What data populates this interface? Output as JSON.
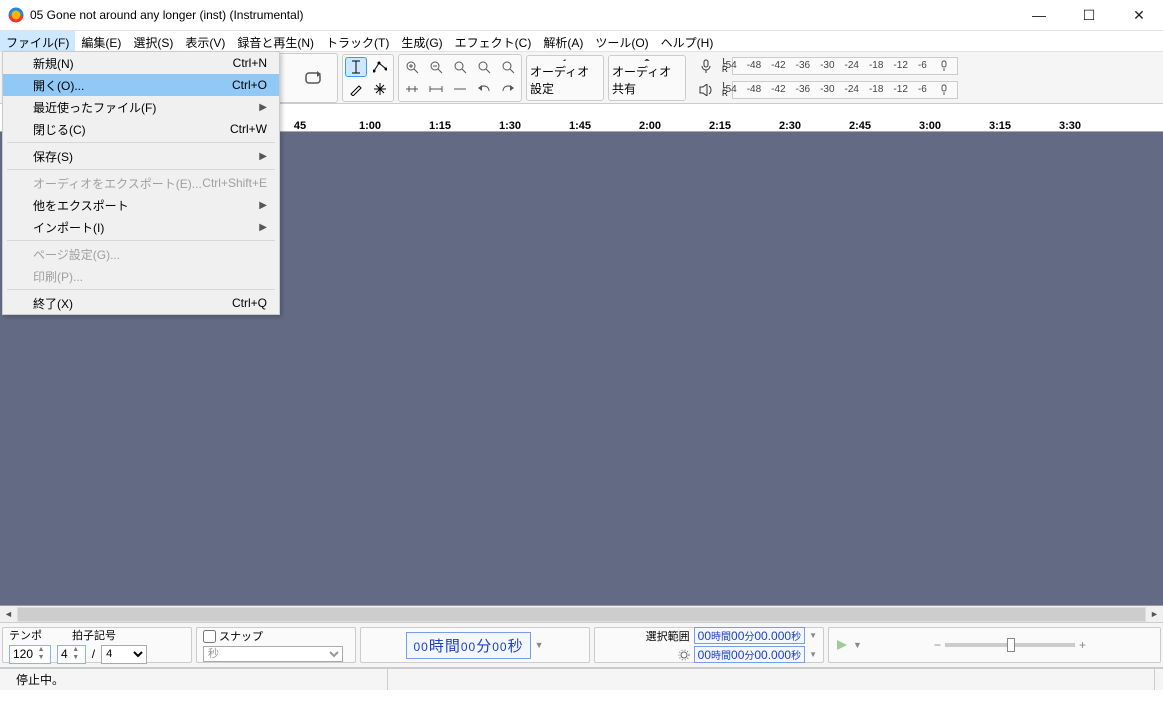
{
  "window": {
    "title": "05 Gone not around any longer (inst) (Instrumental)"
  },
  "menubar": [
    "ファイル(F)",
    "編集(E)",
    "選択(S)",
    "表示(V)",
    "録音と再生(N)",
    "トラック(T)",
    "生成(G)",
    "エフェクト(C)",
    "解析(A)",
    "ツール(O)",
    "ヘルプ(H)"
  ],
  "menu_open_index": 0,
  "file_menu": [
    {
      "label": "新規(N)",
      "accel": "Ctrl+N"
    },
    {
      "label": "開く(O)...",
      "accel": "Ctrl+O",
      "highlight": true
    },
    {
      "label": "最近使ったファイル(F)",
      "submenu": true
    },
    {
      "label": "閉じる(C)",
      "accel": "Ctrl+W"
    },
    {
      "sep": true
    },
    {
      "label": "保存(S)",
      "submenu": true
    },
    {
      "sep": true
    },
    {
      "label": "オーディオをエクスポート(E)...",
      "accel": "Ctrl+Shift+E",
      "disabled": true
    },
    {
      "label": "他をエクスポート",
      "submenu": true
    },
    {
      "label": "インポート(I)",
      "submenu": true
    },
    {
      "sep": true
    },
    {
      "label": "ページ設定(G)...",
      "disabled": true
    },
    {
      "label": "印刷(P)...",
      "disabled": true
    },
    {
      "sep": true
    },
    {
      "label": "終了(X)",
      "accel": "Ctrl+Q"
    }
  ],
  "toolbar": {
    "audio_setup": "オーディオ設定",
    "audio_share": "オーディオ共有"
  },
  "meter": {
    "ticks": [
      "-54",
      "-48",
      "-42",
      "-36",
      "-30",
      "-24",
      "-18",
      "-12",
      "-6"
    ]
  },
  "timeline": [
    "45",
    "1:00",
    "1:15",
    "1:30",
    "1:45",
    "2:00",
    "2:15",
    "2:30",
    "2:45",
    "3:00",
    "3:15",
    "3:30"
  ],
  "bottom": {
    "tempo_label": "テンポ",
    "tempo_value": "120",
    "timesig_label": "拍子記号",
    "timesig_num": "4",
    "timesig_den": "4",
    "snap_label": "スナップ",
    "snap_unit": "秒",
    "time_main": {
      "h": "00",
      "hl": "時間",
      "m": "00",
      "ml": "分",
      "s": "00",
      "sl": "秒"
    },
    "sel_label": "選択範囲",
    "sel_a": {
      "h": "00",
      "hl": "時間",
      "m": "00",
      "ml": "分",
      "s": "00.000",
      "sl": "秒"
    },
    "sel_b": {
      "h": "00",
      "hl": "時間",
      "m": "00",
      "ml": "分",
      "s": "00.000",
      "sl": "秒"
    },
    "slash": "/"
  },
  "status": {
    "text": "停止中。"
  }
}
